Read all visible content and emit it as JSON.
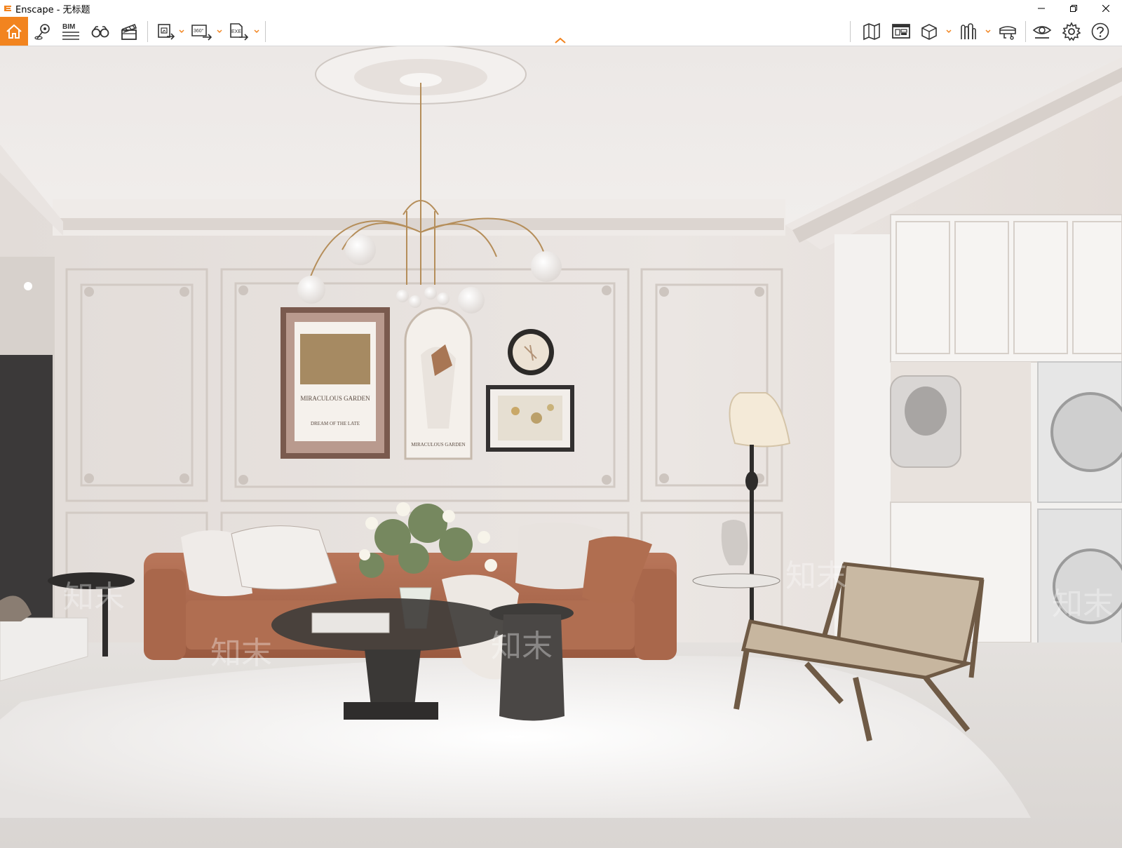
{
  "window": {
    "title": "Enscape - 无标题",
    "accent_color": "#f2841f"
  },
  "toolbar": {
    "left_tools": [
      {
        "name": "home-icon"
      },
      {
        "name": "location-pin-icon"
      },
      {
        "name": "bim-info-icon",
        "label": "BIM"
      },
      {
        "name": "binoculars-icon"
      },
      {
        "name": "clapperboard-icon"
      }
    ],
    "export_tools": [
      {
        "name": "batch-render-icon"
      },
      {
        "name": "panorama-360-icon",
        "label": "360°"
      },
      {
        "name": "exe-export-icon",
        "label": "EXE"
      }
    ],
    "right_tools": [
      {
        "name": "map-icon"
      },
      {
        "name": "minimap-icon"
      },
      {
        "name": "cube-view-icon"
      },
      {
        "name": "asset-library-icon"
      },
      {
        "name": "vr-headset-icon"
      },
      {
        "name": "eye-visual-icon"
      },
      {
        "name": "settings-gear-icon"
      },
      {
        "name": "help-icon"
      }
    ]
  },
  "viewport": {
    "scene": "living-room-render",
    "poster_text": "MIRACULOUS GARDEN",
    "poster_sub": "DREAM OF THE LATE",
    "arch_text": "MIRACULOUS GARDEN",
    "watermark": "知末"
  }
}
